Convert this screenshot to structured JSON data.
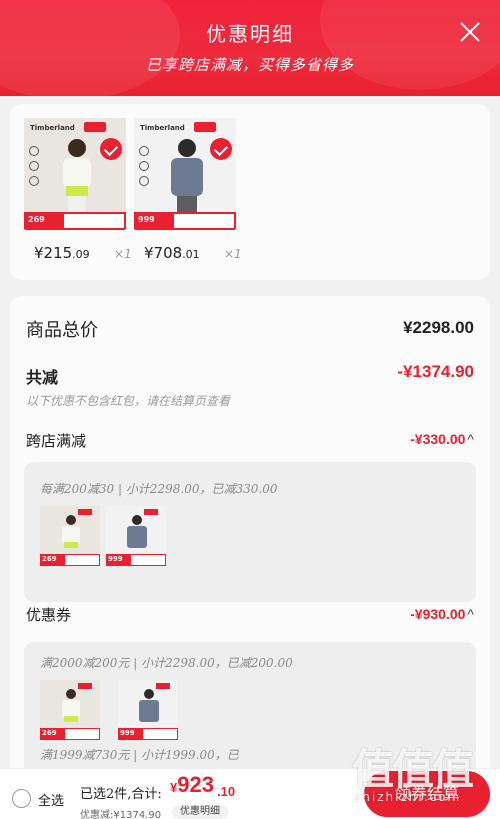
{
  "header": {
    "title": "优惠明细",
    "subtitle": "已享跨店满减，买得多省得多"
  },
  "products": [
    {
      "brand": "Timberland",
      "price_int": "¥215",
      "price_dec": ".09",
      "qty": "×1",
      "thumb_price": "269"
    },
    {
      "brand": "Timberland",
      "price_int": "¥708",
      "price_dec": ".01",
      "qty": "×1",
      "thumb_price": "999"
    }
  ],
  "summary": {
    "total_label": "商品总价",
    "total_value": "¥2298.00",
    "reduce_label": "共减",
    "reduce_value": "-¥1374.90",
    "note": "以下优惠不包含红包，请在结算页查看"
  },
  "cross_store": {
    "label": "跨店满减",
    "value": "-¥330.00",
    "detail": "每满200减30 | 小计2298.00，已减330.00"
  },
  "coupon": {
    "label": "优惠券",
    "value": "-¥930.00",
    "detail1": "满2000减200元 | 小计2298.00，已减200.00",
    "detail2": "满1999减730元 | 小计1999.00，已"
  },
  "bottom": {
    "select_all": "全选",
    "selected_text": "已选2件,合计:",
    "pay_currency": "¥",
    "pay_int": "923",
    "pay_dec": ".10",
    "discount_text": "优惠减:¥1374.90",
    "detail_button": "优惠明细",
    "checkout": "领券结算"
  },
  "watermark": {
    "big": "值值值",
    "small": "zhizhizhi.com"
  },
  "colors": {
    "accent": "#e8202f",
    "header_bg": "#f0233b"
  }
}
